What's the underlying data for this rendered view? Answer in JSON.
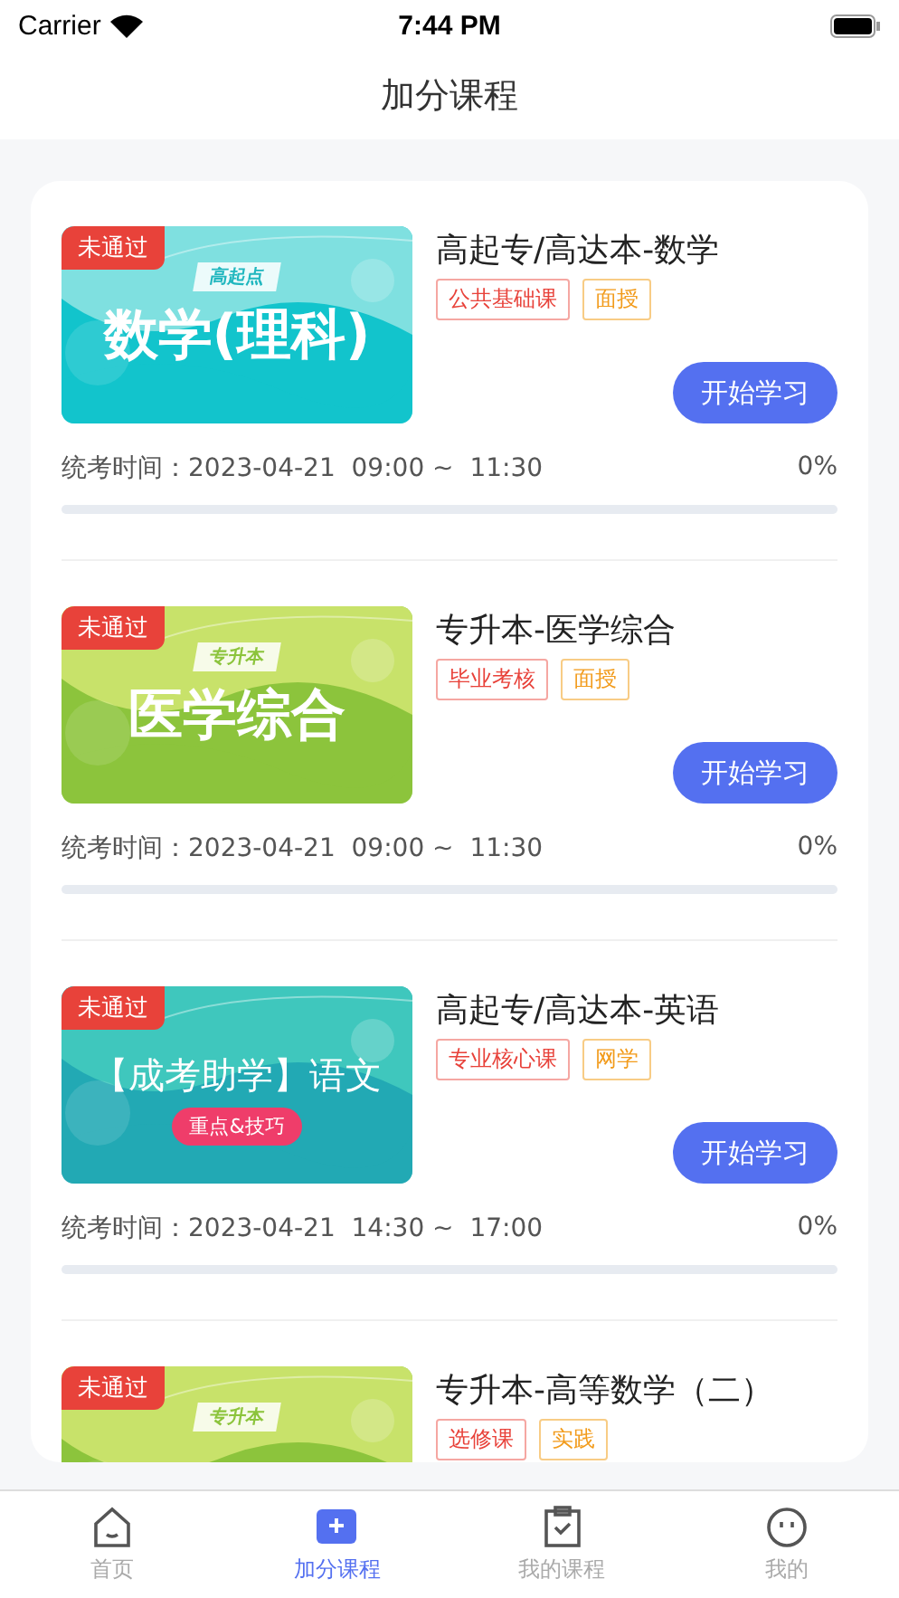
{
  "status_bar": {
    "carrier": "Carrier",
    "time": "7:44 PM"
  },
  "nav": {
    "title": "加分课程"
  },
  "courses": [
    {
      "status": "未通过",
      "cover": {
        "kind": "teal",
        "label": "高起点",
        "title": "数学(理科)"
      },
      "title": "高起专/高达本-数学",
      "tags": [
        {
          "text": "公共基础课",
          "kind": "category"
        },
        {
          "text": "面授",
          "kind": "mode"
        }
      ],
      "button": "开始学习",
      "exam": "统考时间：2023-04-21  09:00 ~  11:30",
      "percent": "0%",
      "level": 0
    },
    {
      "status": "未通过",
      "cover": {
        "kind": "green",
        "label": "专升本",
        "title": "医学综合"
      },
      "title": "专升本-医学综合",
      "tags": [
        {
          "text": "毕业考核",
          "kind": "category"
        },
        {
          "text": "面授",
          "kind": "mode"
        }
      ],
      "button": "开始学习",
      "exam": "统考时间：2023-04-21  09:00 ~  11:30",
      "percent": "0%",
      "level": 0
    },
    {
      "status": "未通过",
      "cover": {
        "kind": "sea",
        "title": "【成考助学】语文",
        "pill": "重点&技巧"
      },
      "title": "高起专/高达本-英语",
      "tags": [
        {
          "text": "专业核心课",
          "kind": "category"
        },
        {
          "text": "网学",
          "kind": "mode"
        }
      ],
      "button": "开始学习",
      "exam": "统考时间：2023-04-21  14:30 ~  17:00",
      "percent": "0%",
      "level": 0
    },
    {
      "status": "未通过",
      "cover": {
        "kind": "green",
        "label": "专升本"
      },
      "title": "专升本-高等数学（二）",
      "tags": [
        {
          "text": "选修课",
          "kind": "category"
        },
        {
          "text": "实践",
          "kind": "mode"
        }
      ]
    }
  ],
  "tab_bar": [
    {
      "label": "首页",
      "kind": "home",
      "selected": false
    },
    {
      "label": "加分课程",
      "kind": "book",
      "selected": true
    },
    {
      "label": "我的课程",
      "kind": "clipboard",
      "selected": false
    },
    {
      "label": "我的",
      "kind": "face",
      "selected": false
    }
  ]
}
